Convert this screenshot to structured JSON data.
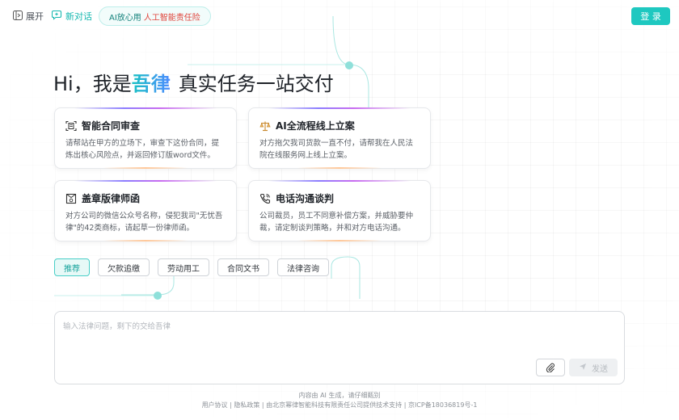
{
  "header": {
    "expand_label": "展开",
    "new_chat_label": "新对话",
    "promo_part1": "AI放心用",
    "promo_part2": "人工智能责任险",
    "login_label": "登 录"
  },
  "hero": {
    "greeting": "Hi，我是",
    "brand": "吾律",
    "tagline": "真实任务一站交付"
  },
  "cards": [
    {
      "icon": "contract-scan-icon",
      "title": "智能合同审查",
      "desc": "请帮站在甲方的立场下，审查下这份合同，提炼出核心风险点，并返回修订版word文件。"
    },
    {
      "icon": "scales-icon",
      "title": "AI全流程线上立案",
      "desc": "对方拖欠我司货款一直不付，请帮我在人民法院在线服务网上线上立案。"
    },
    {
      "icon": "stamp-letter-icon",
      "title": "盖章版律师函",
      "desc": "对方公司的微信公众号名称，侵犯我司\"无忧吾律\"的42类商标，请起草一份律师函。"
    },
    {
      "icon": "phone-icon",
      "title": "电话沟通谈判",
      "desc": "公司裁员，员工不同意补偿方案，并威胁要仲裁，请定制谈判策略，并和对方电话沟通。"
    }
  ],
  "chips": [
    "推荐",
    "欠款追缴",
    "劳动用工",
    "合同文书",
    "法律咨询"
  ],
  "input": {
    "placeholder": "输入法律问题，剩下的交给吾律",
    "send_label": "发送"
  },
  "footer": {
    "line1": "内容由 AI 生成，请仔细甄别",
    "user_agreement": "用户协议",
    "privacy": "隐私政策",
    "provider": "由北京幂律智能科技有限责任公司提供技术支持",
    "icp": "京ICP备18036819号-1"
  },
  "colors": {
    "accent": "#1ec8c0",
    "promo_red": "#e0453c"
  }
}
